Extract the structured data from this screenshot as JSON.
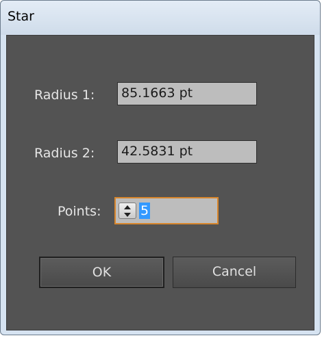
{
  "window": {
    "title": "Star"
  },
  "radius1": {
    "label": "Radius 1:",
    "value": "85.1663 pt"
  },
  "radius2": {
    "label": "Radius 2:",
    "value": "42.5831 pt"
  },
  "points": {
    "label": "Points:",
    "value": "5"
  },
  "buttons": {
    "ok": "OK",
    "cancel": "Cancel"
  },
  "colors": {
    "panel_bg": "#535353",
    "field_bg": "#bdbdbd",
    "focus_border": "#d8862c",
    "selection": "#3399ff"
  }
}
